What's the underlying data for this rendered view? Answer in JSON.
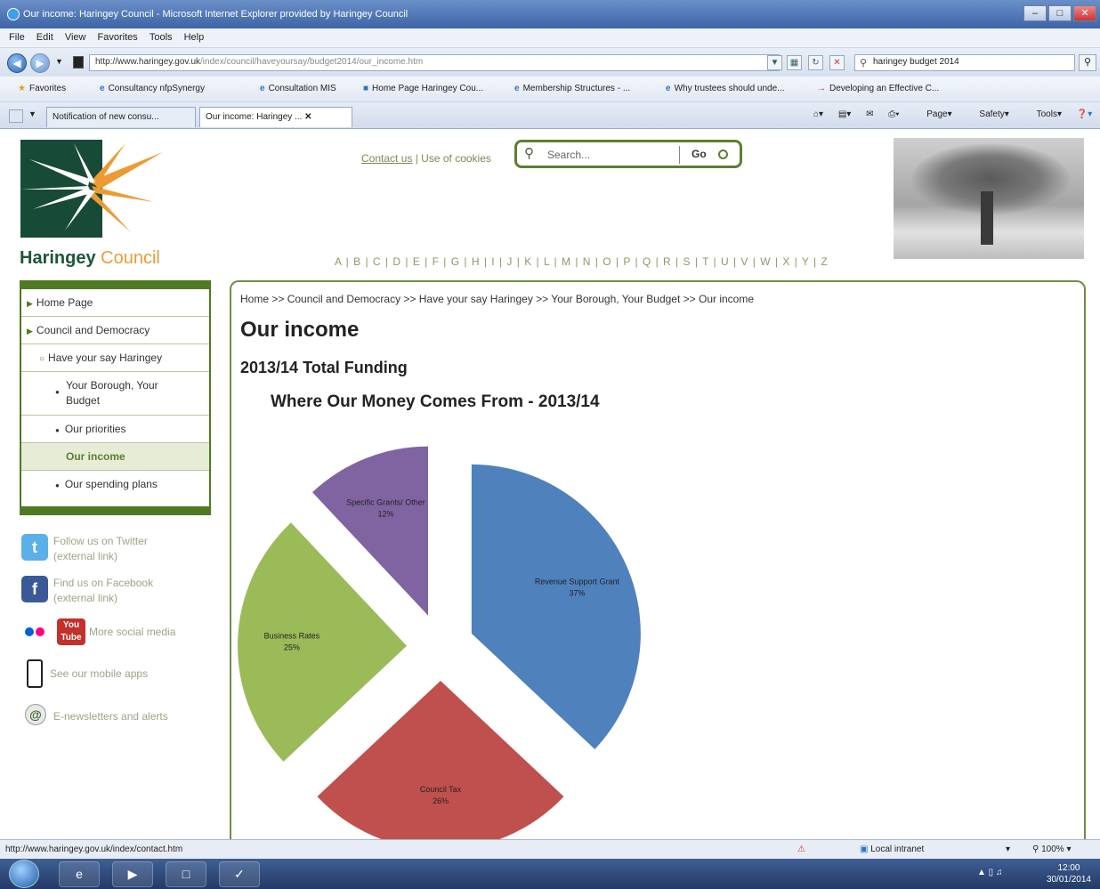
{
  "window": {
    "title": "Our income: Haringey Council - Microsoft Internet Explorer provided by Haringey Council",
    "menu": [
      "File",
      "Edit",
      "View",
      "Favorites",
      "Tools",
      "Help"
    ],
    "url_host": "http://www.haringey.gov.uk",
    "url_path": "/index/council/haveyoursay/budget2014/our_income.htm",
    "search_text": "haringey budget 2014",
    "favorites_label": "Favorites",
    "favorites": [
      "Consultancy nfpSynergy",
      "Consultation MIS",
      "Home Page Haringey Cou...",
      "Membership Structures - ...",
      "Why trustees should unde...",
      "Developing an Effective C..."
    ],
    "tabs": [
      "Notification of new consu...",
      "Our income: Haringey ..."
    ],
    "commands": [
      "Page",
      "Safety",
      "Tools"
    ]
  },
  "site": {
    "logo_word1": "Haringey",
    "logo_word2": "Council",
    "contact_link": "Contact us",
    "cookies_link": "Use of cookies",
    "search_placeholder": "Search...",
    "search_go": "Go",
    "alphabet": "A | B | C | D | E | F | G | H | I | J | K | L | M | N | O | P | Q | R | S | T | U | V | W | X | Y | Z"
  },
  "nav": {
    "items": [
      {
        "label": "Home Page"
      },
      {
        "label": "Council and Democracy"
      },
      {
        "label": "Have your say Haringey"
      },
      {
        "label": "Your Borough, Your Budget"
      },
      {
        "label": "Our priorities"
      },
      {
        "label": "Our income"
      },
      {
        "label": "Our spending plans"
      }
    ]
  },
  "social": {
    "twitter_line1": "Follow us on Twitter",
    "twitter_line2": "(external link)",
    "facebook_line1": "Find us on Facebook",
    "facebook_line2": "(external link)",
    "youtube_glyph": "You Tube",
    "more": "More social media",
    "mobile": "See our mobile apps",
    "enews": "E-newsletters and alerts"
  },
  "content": {
    "breadcrumb": "Home >> Council and Democracy >> Have your say Haringey >> Your Borough, Your Budget >> Our income",
    "heading": "Our income",
    "subheading": "2013/14 Total Funding"
  },
  "chart_data": {
    "type": "pie",
    "title": "Where Our Money Comes From - 2013/14",
    "slices": [
      {
        "label": "Revenue Support Grant",
        "value": 37,
        "display": "37%",
        "color": "#4f81bd"
      },
      {
        "label": "Council Tax",
        "value": 26,
        "display": "26%",
        "color": "#c0504d"
      },
      {
        "label": "Business Rates",
        "value": 25,
        "display": "25%",
        "color": "#9bbb59"
      },
      {
        "label": "Specific Grants/ Other",
        "value": 12,
        "display": "12%",
        "color": "#8064a2"
      }
    ]
  },
  "status": {
    "link": "http://www.haringey.gov.uk/index/contact.htm",
    "zone": "Local intranet",
    "zoom": "100%",
    "time": "12:00",
    "date": "30/01/2014"
  }
}
